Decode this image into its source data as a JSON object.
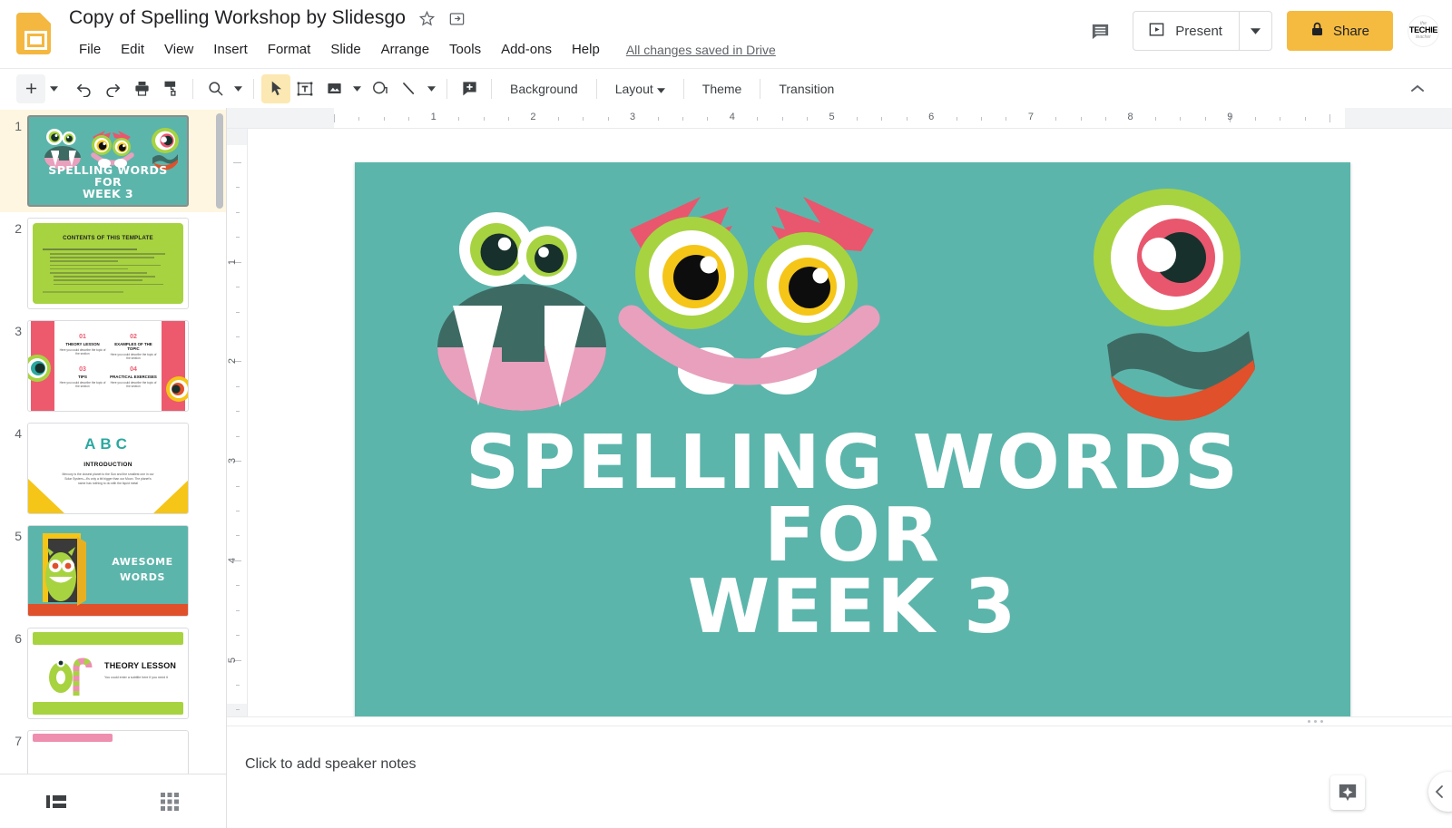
{
  "header": {
    "doc_title": "Copy of Spelling Workshop by Slidesgo",
    "star_icon": "star-outline-icon",
    "move_icon": "move-to-folder-icon",
    "menus": [
      "File",
      "Edit",
      "View",
      "Insert",
      "Format",
      "Slide",
      "Arrange",
      "Tools",
      "Add-ons",
      "Help"
    ],
    "save_state": "All changes saved in Drive",
    "comment_icon": "comment-icon",
    "present_label": "Present",
    "present_icon": "present-play-icon",
    "present_caret_icon": "chevron-down-icon",
    "share_label": "Share",
    "share_lock_icon": "lock-icon",
    "share_color": "#f5bb41",
    "avatar": {
      "line1": "the",
      "line2": "TECHIE",
      "line3": "teacher"
    }
  },
  "toolbar": {
    "new_slide": "add-slide-icon",
    "new_slide_caret": "chevron-down-icon",
    "undo": "undo-icon",
    "redo": "redo-icon",
    "print": "print-icon",
    "paint_format": "paint-format-icon",
    "zoom": "zoom-icon",
    "zoom_caret": "chevron-down-icon",
    "select": "select-arrow-icon",
    "textbox": "text-box-icon",
    "image": "image-icon",
    "image_caret": "chevron-down-icon",
    "shape": "shape-icon",
    "line": "line-icon",
    "line_caret": "chevron-down-icon",
    "comment_add": "add-comment-icon",
    "background_label": "Background",
    "layout_label": "Layout",
    "layout_caret": "chevron-down-icon",
    "theme_label": "Theme",
    "transition_label": "Transition",
    "collapse_icon": "chevron-up-icon"
  },
  "filmstrip": {
    "slides": [
      {
        "number": "1",
        "selected": true,
        "kind": "title-monsters",
        "title_lines": [
          "SPELLING WORDS",
          "FOR",
          "WEEK 3"
        ]
      },
      {
        "number": "2",
        "selected": false,
        "kind": "contents",
        "heading": "CONTENTS OF THIS TEMPLATE"
      },
      {
        "number": "3",
        "selected": false,
        "kind": "four-sections",
        "items": [
          {
            "num": "01",
            "label": "THEORY LESSON",
            "body": "Here you could describe the topic of the section"
          },
          {
            "num": "02",
            "label": "EXAMPLES OF THE TOPIC",
            "body": "Here you could describe the topic of the section"
          },
          {
            "num": "03",
            "label": "TIPS",
            "body": "Here you could describe the topic of the section"
          },
          {
            "num": "04",
            "label": "PRACTICAL EXERCISES",
            "body": "Here you could describe the topic of the section"
          }
        ]
      },
      {
        "number": "4",
        "selected": false,
        "kind": "introduction",
        "heading": "INTRODUCTION",
        "letters": "ABC",
        "body": "Mercury is the closest planet to the Sun and the smallest one in our Solar System—it's only a bit bigger than our Moon. The planet's name has nothing to do with the liquid metal"
      },
      {
        "number": "5",
        "selected": false,
        "kind": "awesome-words",
        "title_lines": [
          "AWESOME",
          "WORDS"
        ]
      },
      {
        "number": "6",
        "selected": false,
        "kind": "theory-lesson",
        "num": "01",
        "heading": "THEORY LESSON",
        "sub": "You could enter a subtitle here if you need it"
      },
      {
        "number": "7",
        "selected": false,
        "kind": "pink-partial"
      }
    ],
    "footer": {
      "filmstrip_view": "filmstrip-view-icon",
      "grid_view": "grid-view-icon"
    },
    "scrollbar": "filmstrip-scrollbar"
  },
  "rulers": {
    "horizontal_labels": [
      "1",
      "2",
      "3",
      "4",
      "5",
      "6",
      "7",
      "8",
      "9"
    ],
    "vertical_labels": [
      "1",
      "2",
      "3",
      "4",
      "5"
    ]
  },
  "slide": {
    "background_color": "#5cb5ab",
    "title_lines": [
      "SPELLING WORDS",
      "FOR",
      "WEEK 3"
    ],
    "title_color": "#ffffff",
    "monsters": [
      {
        "name": "left-fanged-monster",
        "eye_ring": "#a7d340",
        "mouth": "#3d6b64",
        "tongue": "#e8a0bd",
        "teeth": "#ffffff"
      },
      {
        "name": "center-angry-monster",
        "brow": "#e8576d",
        "eye_ring": "#a7d340",
        "iris_ring": "#f5c518",
        "smile": "#e8a0bd"
      },
      {
        "name": "right-cyclops-monster",
        "eye_ring": "#a7d340",
        "iris_ring": "#e8576d",
        "lip": "#3d6b64",
        "mouth": "#e0502a"
      }
    ]
  },
  "notes": {
    "placeholder": "Click to add speaker notes",
    "explore_icon": "explore-sparkle-icon",
    "collapse_icon": "chevron-left-icon"
  }
}
